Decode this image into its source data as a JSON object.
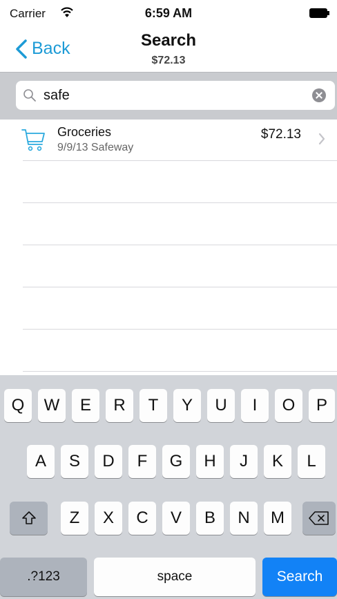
{
  "status": {
    "carrier": "Carrier",
    "time": "6:59 AM"
  },
  "nav": {
    "back_label": "Back",
    "title": "Search",
    "subtitle": "$72.13"
  },
  "search": {
    "query": "safe"
  },
  "results": [
    {
      "title": "Groceries",
      "subtitle": "9/9/13 Safeway",
      "amount": "$72.13",
      "icon": "shopping-cart-icon"
    }
  ],
  "colors": {
    "accent": "#1d9bd6",
    "search_key": "#1282f6",
    "keyboard_bg": "#d1d4d9"
  },
  "keyboard": {
    "row1": [
      "Q",
      "W",
      "E",
      "R",
      "T",
      "Y",
      "U",
      "I",
      "O",
      "P"
    ],
    "row2": [
      "A",
      "S",
      "D",
      "F",
      "G",
      "H",
      "J",
      "K",
      "L"
    ],
    "row3": [
      "Z",
      "X",
      "C",
      "V",
      "B",
      "N",
      "M"
    ],
    "shift_icon": "shift-icon",
    "delete_icon": "delete-icon",
    "numbers_label": ".?123",
    "space_label": "space",
    "search_label": "Search"
  }
}
